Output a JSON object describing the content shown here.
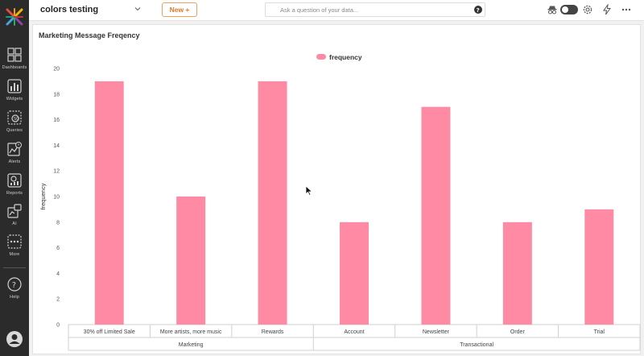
{
  "sidebar": {
    "items": [
      {
        "label": "Dashboards",
        "icon": "dashboards-icon"
      },
      {
        "label": "Widgets",
        "icon": "widgets-icon"
      },
      {
        "label": "Queries",
        "icon": "queries-icon"
      },
      {
        "label": "Alerts",
        "icon": "alerts-icon"
      },
      {
        "label": "Reports",
        "icon": "reports-icon"
      },
      {
        "label": "AI",
        "icon": "ai-icon"
      },
      {
        "label": "More",
        "icon": "more-icon"
      }
    ],
    "help_label": "Help"
  },
  "topbar": {
    "title": "colors testing",
    "new_button": "New +",
    "search_placeholder": "Ask a question of your data..."
  },
  "card": {
    "title": "Marketing Message Freqency"
  },
  "colors": {
    "bar": "#ff8aa3",
    "accent": "#e8761f"
  },
  "chart_data": {
    "type": "bar",
    "title": "",
    "legend": [
      "frequency"
    ],
    "legend_position": "top-center",
    "ylabel": "frequency",
    "xlabel": "",
    "ylim": [
      0,
      20
    ],
    "yticks": [
      0,
      2,
      4,
      6,
      8,
      10,
      12,
      14,
      16,
      18,
      20
    ],
    "grid": false,
    "categories": [
      "30% off Limited Sale",
      "More artists, more music",
      "Rewards",
      "Account",
      "Newsletter",
      "Order",
      "Trial"
    ],
    "groups": [
      {
        "name": "Marketing",
        "span": 3
      },
      {
        "name": "Transactional",
        "span": 4
      }
    ],
    "series": [
      {
        "name": "frequency",
        "values": [
          19,
          10,
          19,
          8,
          17,
          8,
          9
        ]
      }
    ]
  }
}
